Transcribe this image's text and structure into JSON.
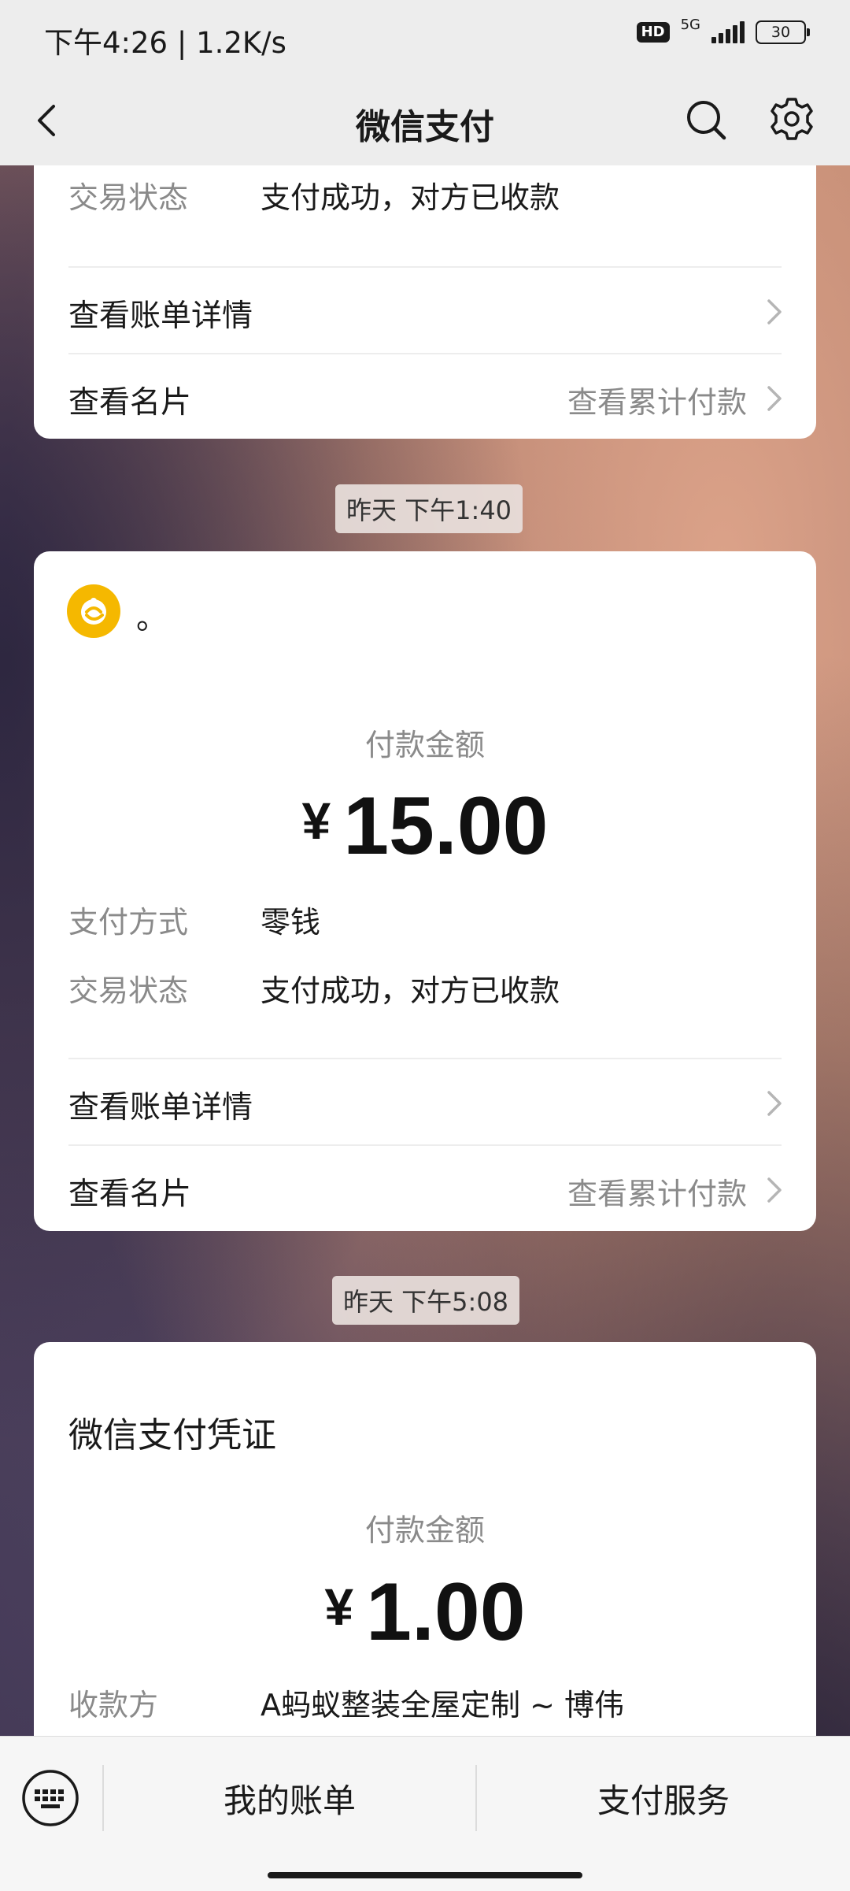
{
  "status_bar": {
    "time": "下午4:26 | 1.2K/s",
    "hd": "HD",
    "network": "5G",
    "battery": "30"
  },
  "nav": {
    "title": "微信支付"
  },
  "card1": {
    "status_label": "交易状态",
    "status_value": "支付成功，对方已收款",
    "bill_detail": "查看账单详情",
    "card_label": "查看名片",
    "cumulative": "查看累计付款"
  },
  "chip1": "昨天 下午1:40",
  "card2": {
    "merchant_name": "。",
    "amount_label": "付款金额",
    "currency": "¥",
    "amount": "15.00",
    "method_label": "支付方式",
    "method_value": "零钱",
    "status_label": "交易状态",
    "status_value": "支付成功，对方已收款",
    "bill_detail": "查看账单详情",
    "card_label": "查看名片",
    "cumulative": "查看累计付款"
  },
  "chip2": "昨天 下午5:08",
  "card3": {
    "title": "微信支付凭证",
    "amount_label": "付款金额",
    "currency": "¥",
    "amount": "1.00",
    "payee_label": "收款方",
    "payee_value": "A蚂蚁整装全屋定制 ~ 博伟"
  },
  "bottom": {
    "bills": "我的账单",
    "service": "支付服务"
  }
}
